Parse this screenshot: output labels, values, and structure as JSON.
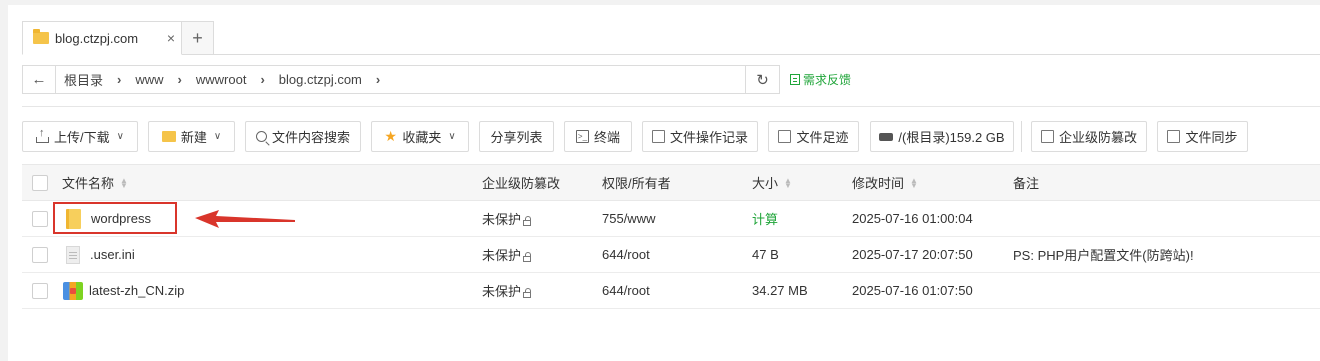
{
  "tab": {
    "label": "blog.ctzpj.com",
    "close": "×",
    "add": "+"
  },
  "breadcrumb": [
    "根目录",
    "www",
    "wwwroot",
    "blog.ctzpj.com"
  ],
  "feedback": "需求反馈",
  "toolbar": {
    "upload": "上传/下载",
    "new": "新建",
    "search": "文件内容搜索",
    "favorites": "收藏夹",
    "share_list": "分享列表",
    "terminal": "终端",
    "op_log": "文件操作记录",
    "footprint": "文件足迹",
    "disk": "/(根目录)159.2 GB",
    "tamper": "企业级防篡改",
    "sync": "文件同步"
  },
  "table": {
    "headers": {
      "name": "文件名称",
      "tamper": "企业级防篡改",
      "perm": "权限/所有者",
      "size": "大小",
      "mtime": "修改时间",
      "note": "备注"
    },
    "rows": [
      {
        "name": "wordpress",
        "type": "folder",
        "tamper": "未保护",
        "perm": "755/www",
        "size": "计算",
        "mtime": "2025-07-16 01:00:04",
        "note": ""
      },
      {
        "name": ".user.ini",
        "type": "file",
        "tamper": "未保护",
        "perm": "644/root",
        "size": "47 B",
        "mtime": "2025-07-17 20:07:50",
        "note": "PS: PHP用户配置文件(防跨站)!"
      },
      {
        "name": "latest-zh_CN.zip",
        "type": "zip",
        "tamper": "未保护",
        "perm": "644/root",
        "size": "34.27 MB",
        "mtime": "2025-07-16 01:07:50",
        "note": ""
      }
    ]
  },
  "colors": {
    "accent_green": "#20a53a",
    "highlight_red": "#d9352b",
    "folder_yellow": "#f5c44a"
  }
}
